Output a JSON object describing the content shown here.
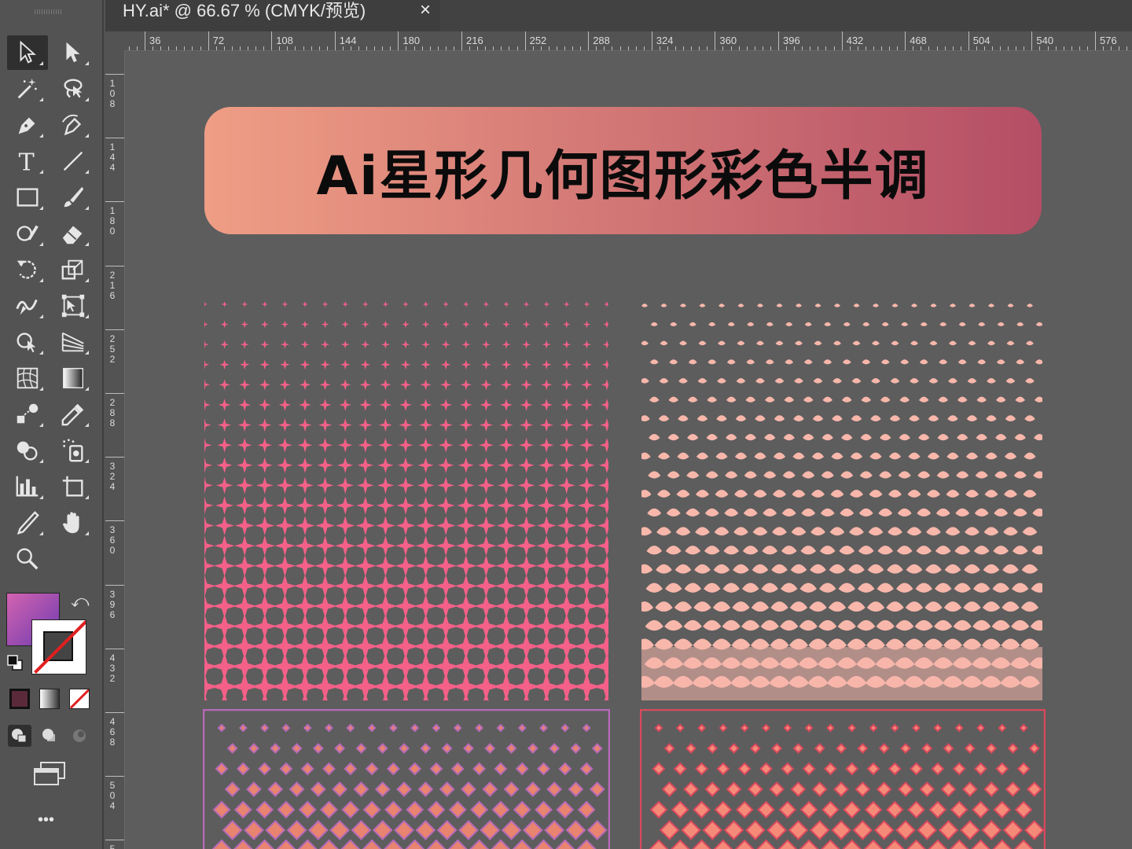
{
  "document": {
    "tab_title": "HY.ai* @ 66.67 % (CMYK/预览)",
    "close_glyph": "×"
  },
  "rulers": {
    "horizontal": [
      "36",
      "72",
      "108",
      "144",
      "180",
      "216",
      "252",
      "288",
      "324",
      "360",
      "396",
      "432",
      "468",
      "504",
      "540",
      "576"
    ],
    "vertical": [
      "108",
      "144",
      "180",
      "216",
      "252",
      "288",
      "324",
      "360",
      "396",
      "432",
      "468",
      "504",
      "5"
    ]
  },
  "tools": [
    {
      "name": "selection-tool",
      "icon": "selection-arrow-icon"
    },
    {
      "name": "direct-selection-tool",
      "icon": "direct-selection-arrow-icon"
    },
    {
      "name": "magic-wand-tool",
      "icon": "magic-wand-icon"
    },
    {
      "name": "lasso-tool",
      "icon": "lasso-icon"
    },
    {
      "name": "pen-tool",
      "icon": "pen-icon"
    },
    {
      "name": "curvature-tool",
      "icon": "curvature-pen-icon"
    },
    {
      "name": "type-tool",
      "icon": "type-icon"
    },
    {
      "name": "line-tool",
      "icon": "line-segment-icon"
    },
    {
      "name": "rectangle-tool",
      "icon": "rectangle-icon"
    },
    {
      "name": "paintbrush-tool",
      "icon": "paintbrush-icon"
    },
    {
      "name": "shaper-tool",
      "icon": "shaper-icon"
    },
    {
      "name": "eraser-tool",
      "icon": "eraser-icon"
    },
    {
      "name": "rotate-tool",
      "icon": "rotate-icon"
    },
    {
      "name": "scale-tool",
      "icon": "scale-icon"
    },
    {
      "name": "warp-tool",
      "icon": "warp-icon"
    },
    {
      "name": "free-transform-tool",
      "icon": "free-transform-icon"
    },
    {
      "name": "shape-builder-tool",
      "icon": "shape-builder-icon"
    },
    {
      "name": "perspective-grid-tool",
      "icon": "perspective-grid-icon"
    },
    {
      "name": "mesh-tool",
      "icon": "mesh-icon"
    },
    {
      "name": "gradient-tool",
      "icon": "gradient-icon"
    },
    {
      "name": "blend-tool",
      "icon": "blend-icon"
    },
    {
      "name": "eyedropper-tool",
      "icon": "eyedropper-icon"
    },
    {
      "name": "live-paint-tool",
      "icon": "live-paint-icon"
    },
    {
      "name": "symbol-sprayer-tool",
      "icon": "symbol-sprayer-icon"
    },
    {
      "name": "graph-tool",
      "icon": "column-graph-icon"
    },
    {
      "name": "artboard-tool",
      "icon": "artboard-icon"
    },
    {
      "name": "slice-tool",
      "icon": "slice-knife-icon"
    },
    {
      "name": "hand-tool",
      "icon": "hand-icon"
    },
    {
      "name": "zoom-tool",
      "icon": "zoom-icon"
    }
  ],
  "swatches": {
    "fill_gradient": [
      "#d363b0",
      "#6d3bb0"
    ],
    "stroke": "none"
  },
  "more_tools_glyph": "•••",
  "artboard": {
    "banner_title": "Ai星形几何图形彩色半调",
    "banner_gradient": [
      "#ef9e85",
      "#b44e65"
    ],
    "patterns": [
      {
        "name": "star-halftone",
        "color": "#f46088"
      },
      {
        "name": "scale-halftone",
        "color": "#f8b7ab"
      },
      {
        "name": "diamond-halftone-purple",
        "color": "#b86ab8",
        "inner": "#e8846f"
      },
      {
        "name": "diamond-halftone-red",
        "color": "#d9495e",
        "inner": "#f58a78"
      }
    ]
  }
}
